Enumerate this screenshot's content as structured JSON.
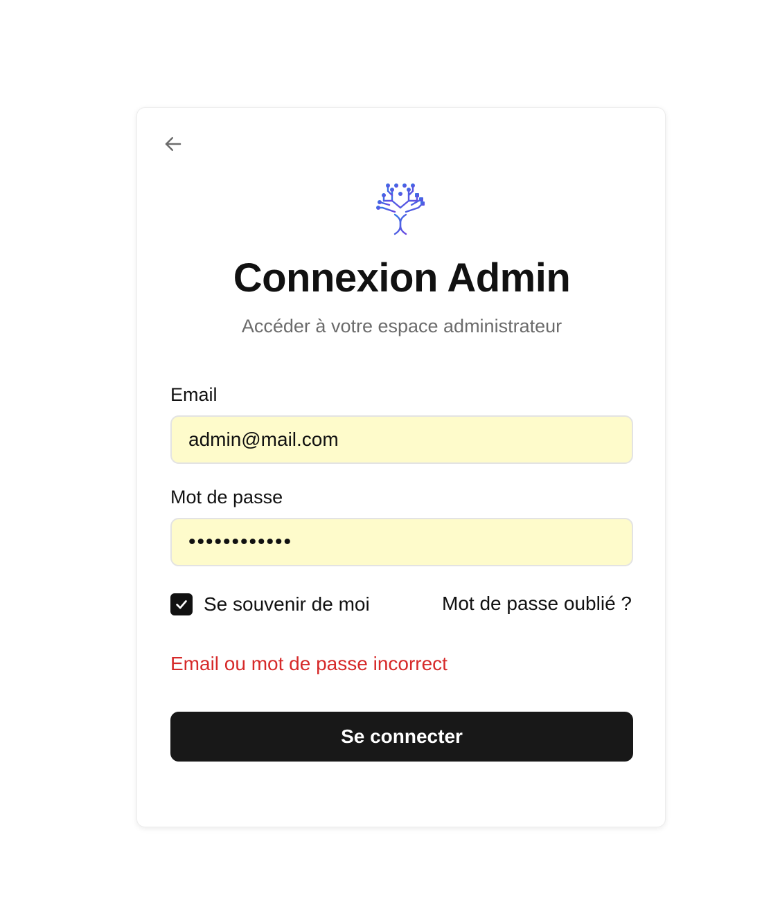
{
  "header": {
    "back_icon": "arrow-left-icon",
    "logo_icon": "dna-tree-logo",
    "title": "Connexion Admin",
    "subtitle": "Accéder à votre espace administrateur"
  },
  "form": {
    "email_label": "Email",
    "email_value": "admin@mail.com",
    "password_label": "Mot de passe",
    "password_value": "••••••••••••",
    "remember_label": "Se souvenir de moi",
    "remember_checked": true,
    "forgot_label": "Mot de passe oublié ?",
    "error_message": "Email ou mot de passe incorrect",
    "submit_label": "Se connecter"
  },
  "colors": {
    "input_background": "#fefbcb",
    "error": "#d62a2a",
    "button": "#181818",
    "logo_blue": "#2f6fe4",
    "logo_purple": "#6a45e0"
  }
}
